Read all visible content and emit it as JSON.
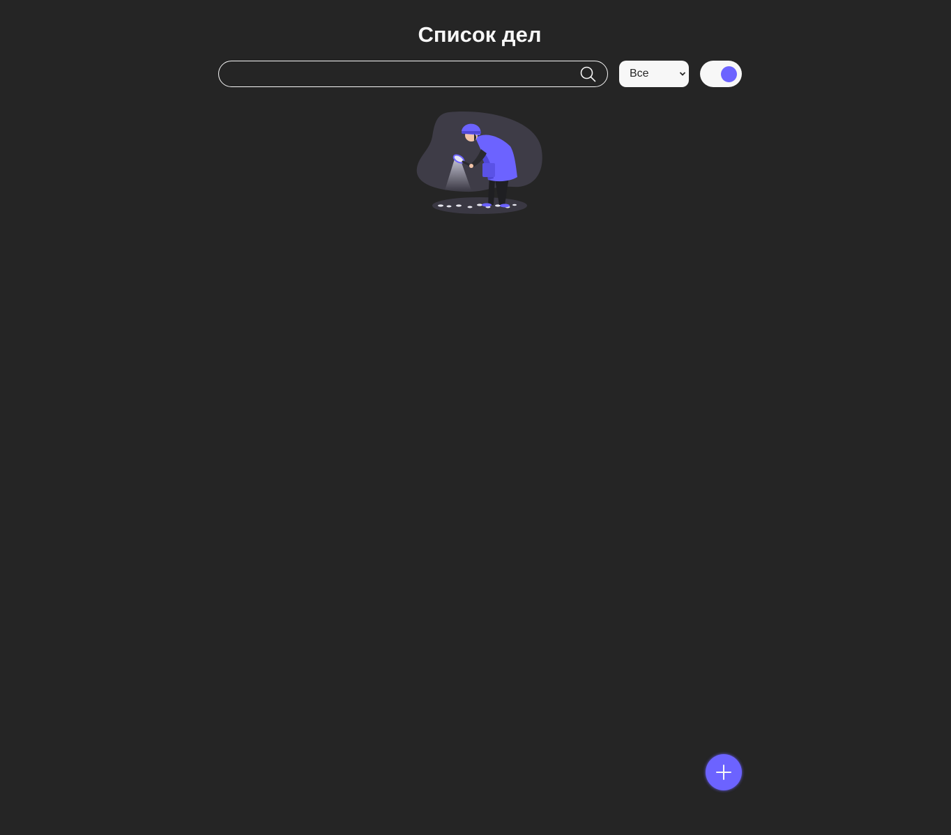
{
  "header": {
    "title": "Список дел"
  },
  "search": {
    "value": "",
    "placeholder": "",
    "icon": "search-icon"
  },
  "filter": {
    "selected": "Все",
    "icon": "chevron-down-icon"
  },
  "theme_toggle": {
    "state": "dark",
    "knob_color": "#6c63ff"
  },
  "empty_state": {
    "illustration": "detective-searching-illustration"
  },
  "add_button": {
    "icon": "plus-icon"
  },
  "colors": {
    "background": "#252525",
    "accent": "#6c63ff",
    "foreground": "#f7f7f7"
  }
}
